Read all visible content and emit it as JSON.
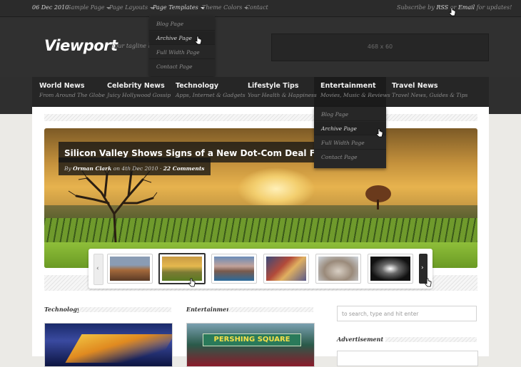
{
  "topbar": {
    "date": "06 Dec 2010",
    "menu": [
      {
        "label": "Sample Page",
        "has_caret": true
      },
      {
        "label": "Page Layouts",
        "has_caret": true
      },
      {
        "label": "Page Templates",
        "has_caret": true
      },
      {
        "label": "Theme Colors",
        "has_caret": true
      },
      {
        "label": "Contact",
        "has_caret": false
      }
    ],
    "subscribe_prefix": "Subscribe by",
    "subscribe_rss": "RSS",
    "subscribe_or": "or",
    "subscribe_email": "Email",
    "subscribe_suffix": "for updates!"
  },
  "page_templates_menu": [
    "Blog Page",
    "Archive Page",
    "Full Width Page",
    "Contact Page"
  ],
  "header": {
    "logo": "Viewport",
    "tagline": "Your tagline here",
    "ad": "468 x 60"
  },
  "nav": [
    {
      "title": "World News",
      "sub": "From Around The Globe"
    },
    {
      "title": "Celebrity News",
      "sub": "Juicy Hollywood Gossip"
    },
    {
      "title": "Technology",
      "sub": "Apps, Internet & Gadgets"
    },
    {
      "title": "Lifestyle Tips",
      "sub": "Your Health & Happiness"
    },
    {
      "title": "Entertainment",
      "sub": "Movies, Music & Reviews"
    },
    {
      "title": "Travel News",
      "sub": "Travel News, Guides & Tips"
    }
  ],
  "entertainment_menu": [
    "Blog Page",
    "Archive Page",
    "Full Width Page",
    "Contact Page"
  ],
  "hero": {
    "title": "Silicon Valley Shows Signs of a New Dot-Com Deal Frenzy",
    "meta_by": "By",
    "author": "Orman Clark",
    "meta_on": "on 4th Dec 2010 ·",
    "comments": "22 Comments"
  },
  "thumbnails": {
    "count": 6,
    "active_index": 1,
    "prev_glyph": "‹",
    "next_glyph": "›"
  },
  "sections": {
    "technology": "Technology",
    "entertainment": "Entertainment",
    "advertisement": "Advertisement",
    "pershing_sign": "PERSHING SQUARE"
  },
  "search": {
    "placeholder": "to search, type and hit enter"
  },
  "colors": {
    "accent": "#ffffff",
    "dark": "#2b2b2b",
    "nav": "#262626"
  }
}
